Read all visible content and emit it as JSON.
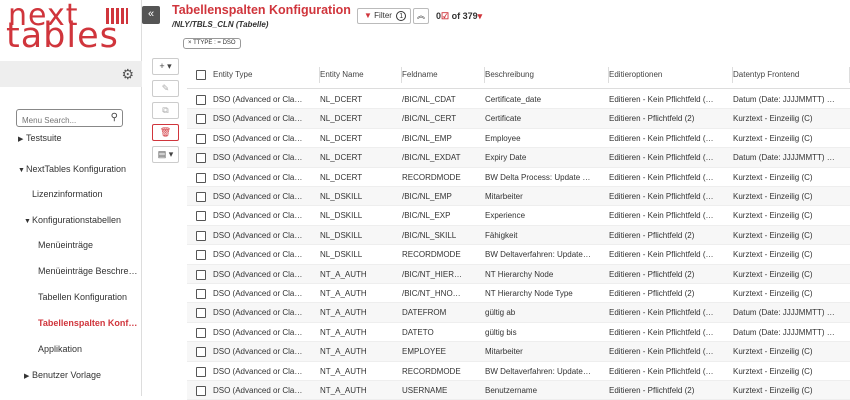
{
  "logo": {
    "line1": "next",
    "line2": "tables"
  },
  "sidebar": {
    "search_placeholder": "Menu Search...",
    "items": [
      {
        "label": "Testsuite",
        "caret": "▶",
        "active": false
      },
      {
        "label": "NextTables Konfiguration",
        "caret": "▼",
        "active": false
      },
      {
        "label": "Lizenzinformation",
        "caret": "",
        "active": false
      },
      {
        "label": "Konfigurationstabellen",
        "caret": "▼",
        "active": false
      },
      {
        "label": "Menüeinträge",
        "caret": "",
        "active": false
      },
      {
        "label": "Menüeinträge Beschre…",
        "caret": "",
        "active": false
      },
      {
        "label": "Tabellen Konfiguration",
        "caret": "",
        "active": false
      },
      {
        "label": "Tabellenspalten Konfi…",
        "caret": "",
        "active": true
      },
      {
        "label": "Applikation",
        "caret": "",
        "active": false
      },
      {
        "label": "Benutzer Vorlage",
        "caret": "▶",
        "active": false
      }
    ]
  },
  "header": {
    "collapse_icon": "«",
    "title": "Tabellenspalten Konfiguration",
    "subtitle": "/NLY/TBLS_CLN (Tabelle)",
    "filter_label": "Filter",
    "filter_count": "1",
    "up_icon": "⌃⌃",
    "count_prefix": "0",
    "count_text": "of 379",
    "chip": "× TTYPE : = DSO"
  },
  "toolbar": {
    "add": "+ ▾",
    "edit": "✎",
    "copy": "⧉",
    "delete": "🗑",
    "export": "▤ ▾"
  },
  "table": {
    "columns": [
      "Entity Type",
      "Entity Name",
      "Feldname",
      "Beschreibung",
      "Editieroptionen",
      "Datentyp Frontend"
    ],
    "rows": [
      [
        "DSO (Advanced or Cla…",
        "NL_DCERT",
        "/BIC/NL_CDAT",
        "Certificate_date",
        "Editieren - Kein Pflichtfeld (…",
        "Datum (Date: JJJJMMTT) …"
      ],
      [
        "DSO (Advanced or Cla…",
        "NL_DCERT",
        "/BIC/NL_CERT",
        "Certificate",
        "Editieren - Pflichtfeld (2)",
        "Kurztext - Einzeilig (C)"
      ],
      [
        "DSO (Advanced or Cla…",
        "NL_DCERT",
        "/BIC/NL_EMP",
        "Employee",
        "Editieren - Kein Pflichtfeld (…",
        "Kurztext - Einzeilig (C)"
      ],
      [
        "DSO (Advanced or Cla…",
        "NL_DCERT",
        "/BIC/NL_EXDAT",
        "Expiry Date",
        "Editieren - Kein Pflichtfeld (…",
        "Datum (Date: JJJJMMTT) …"
      ],
      [
        "DSO (Advanced or Cla…",
        "NL_DCERT",
        "RECORDMODE",
        "BW Delta Process: Update …",
        "Editieren - Kein Pflichtfeld (…",
        "Kurztext - Einzeilig (C)"
      ],
      [
        "DSO (Advanced or Cla…",
        "NL_DSKILL",
        "/BIC/NL_EMP",
        "Mitarbeiter",
        "Editieren - Kein Pflichtfeld (…",
        "Kurztext - Einzeilig (C)"
      ],
      [
        "DSO (Advanced or Cla…",
        "NL_DSKILL",
        "/BIC/NL_EXP",
        "Experience",
        "Editieren - Kein Pflichtfeld (…",
        "Kurztext - Einzeilig (C)"
      ],
      [
        "DSO (Advanced or Cla…",
        "NL_DSKILL",
        "/BIC/NL_SKILL",
        "Fähigkeit",
        "Editieren - Pflichtfeld (2)",
        "Kurztext - Einzeilig (C)"
      ],
      [
        "DSO (Advanced or Cla…",
        "NL_DSKILL",
        "RECORDMODE",
        "BW Deltaverfahren: Update…",
        "Editieren - Kein Pflichtfeld (…",
        "Kurztext - Einzeilig (C)"
      ],
      [
        "DSO (Advanced or Cla…",
        "NT_A_AUTH",
        "/BIC/NT_HIER…",
        "NT Hierarchy Node",
        "Editieren - Pflichtfeld (2)",
        "Kurztext - Einzeilig (C)"
      ],
      [
        "DSO (Advanced or Cla…",
        "NT_A_AUTH",
        "/BIC/NT_HNO…",
        "NT Hierarchy Node Type",
        "Editieren - Pflichtfeld (2)",
        "Kurztext - Einzeilig (C)"
      ],
      [
        "DSO (Advanced or Cla…",
        "NT_A_AUTH",
        "DATEFROM",
        "gültig ab",
        "Editieren - Kein Pflichtfeld (…",
        "Datum (Date: JJJJMMTT) …"
      ],
      [
        "DSO (Advanced or Cla…",
        "NT_A_AUTH",
        "DATETO",
        "gültig bis",
        "Editieren - Kein Pflichtfeld (…",
        "Datum (Date: JJJJMMTT) …"
      ],
      [
        "DSO (Advanced or Cla…",
        "NT_A_AUTH",
        "EMPLOYEE",
        "Mitarbeiter",
        "Editieren - Kein Pflichtfeld (…",
        "Kurztext - Einzeilig (C)"
      ],
      [
        "DSO (Advanced or Cla…",
        "NT_A_AUTH",
        "RECORDMODE",
        "BW Deltaverfahren: Update…",
        "Editieren - Kein Pflichtfeld (…",
        "Kurztext - Einzeilig (C)"
      ],
      [
        "DSO (Advanced or Cla…",
        "NT_A_AUTH",
        "USERNAME",
        "Benutzername",
        "Editieren - Pflichtfeld (2)",
        "Kurztext - Einzeilig (C)"
      ]
    ]
  }
}
